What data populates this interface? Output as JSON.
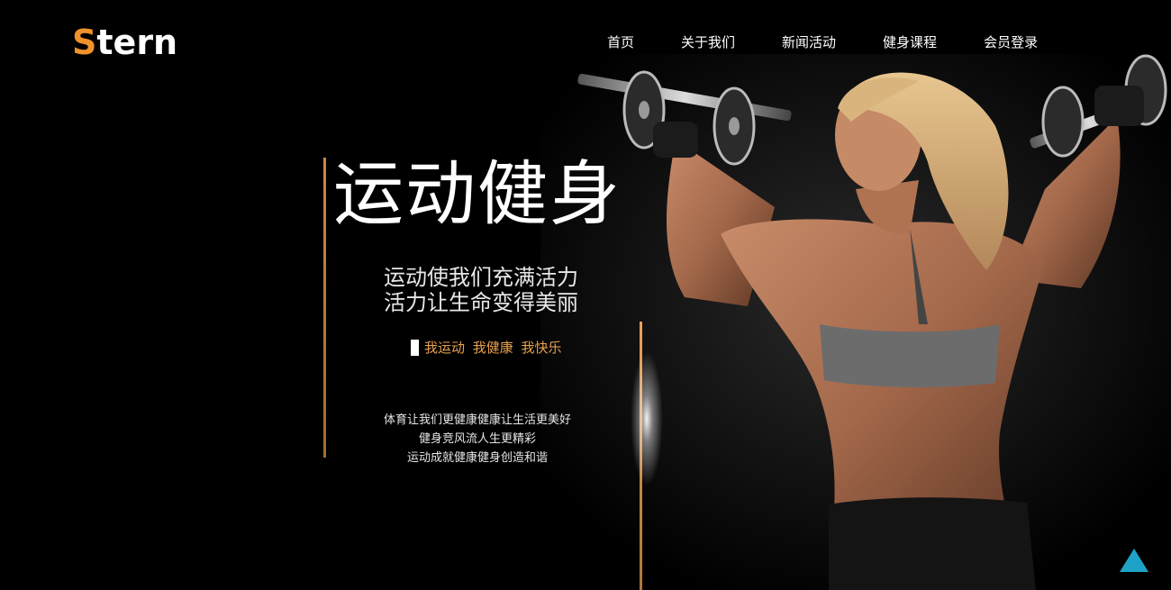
{
  "header": {
    "logo_first": "S",
    "logo_rest": "tern",
    "nav": [
      {
        "label": "首页"
      },
      {
        "label": "关于我们"
      },
      {
        "label": "新闻活动"
      },
      {
        "label": "健身课程"
      },
      {
        "label": "会员登录"
      }
    ]
  },
  "hero": {
    "title": "运动健身",
    "subtitle_line1": "运动使我们充满活力",
    "subtitle_line2": "活力让生命变得美丽",
    "tagline": "我运动 我健康 我快乐",
    "desc_line1": "体育让我们更健康健康让生活更美好",
    "desc_line2": "健身竞风流人生更精彩",
    "desc_line3": "运动成就健康健身创造和谐",
    "image": "woman-lifting-dumbbells-photo"
  },
  "colors": {
    "background": "#000000",
    "accent_orange": "#f0922b",
    "tagline_gold": "#e8a14e",
    "back_to_top": "#1ea3c6"
  },
  "controls": {
    "back_to_top_icon": "triangle-up-icon"
  }
}
